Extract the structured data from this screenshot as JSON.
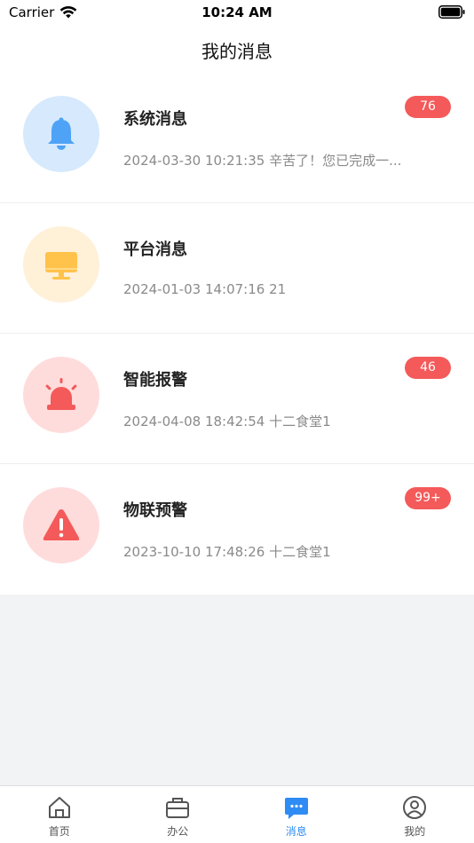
{
  "status_bar": {
    "carrier": "Carrier",
    "time": "10:24 AM"
  },
  "header": {
    "title": "我的消息"
  },
  "messages": [
    {
      "title": "系统消息",
      "subtitle": "2024-03-30 10:21:35 辛苦了！您已完成一...",
      "badge": "76",
      "icon": "bell-icon",
      "icon_bg": "#d6e9fd",
      "icon_color": "#4ea3f7"
    },
    {
      "title": "平台消息",
      "subtitle": "2024-01-03 14:07:16 21",
      "badge": "",
      "icon": "monitor-icon",
      "icon_bg": "#fff0d8",
      "icon_color": "#ffc24a"
    },
    {
      "title": "智能报警",
      "subtitle": "2024-04-08 18:42:54 十二食堂1",
      "badge": "46",
      "icon": "alarm-light-icon",
      "icon_bg": "#ffdcdc",
      "icon_color": "#f45a5a"
    },
    {
      "title": "物联预警",
      "subtitle": "2023-10-10 17:48:26 十二食堂1",
      "badge": "99+",
      "icon": "warning-icon",
      "icon_bg": "#ffdcdc",
      "icon_color": "#f45a5a"
    }
  ],
  "tabbar": {
    "items": [
      {
        "label": "首页",
        "icon": "home-icon"
      },
      {
        "label": "办公",
        "icon": "briefcase-icon"
      },
      {
        "label": "消息",
        "icon": "chat-bubble-icon",
        "active": true
      },
      {
        "label": "我的",
        "icon": "profile-icon"
      }
    ],
    "active_color": "#2f8cf5",
    "inactive_color": "#555555"
  },
  "colors": {
    "badge": "#f45a5a"
  }
}
